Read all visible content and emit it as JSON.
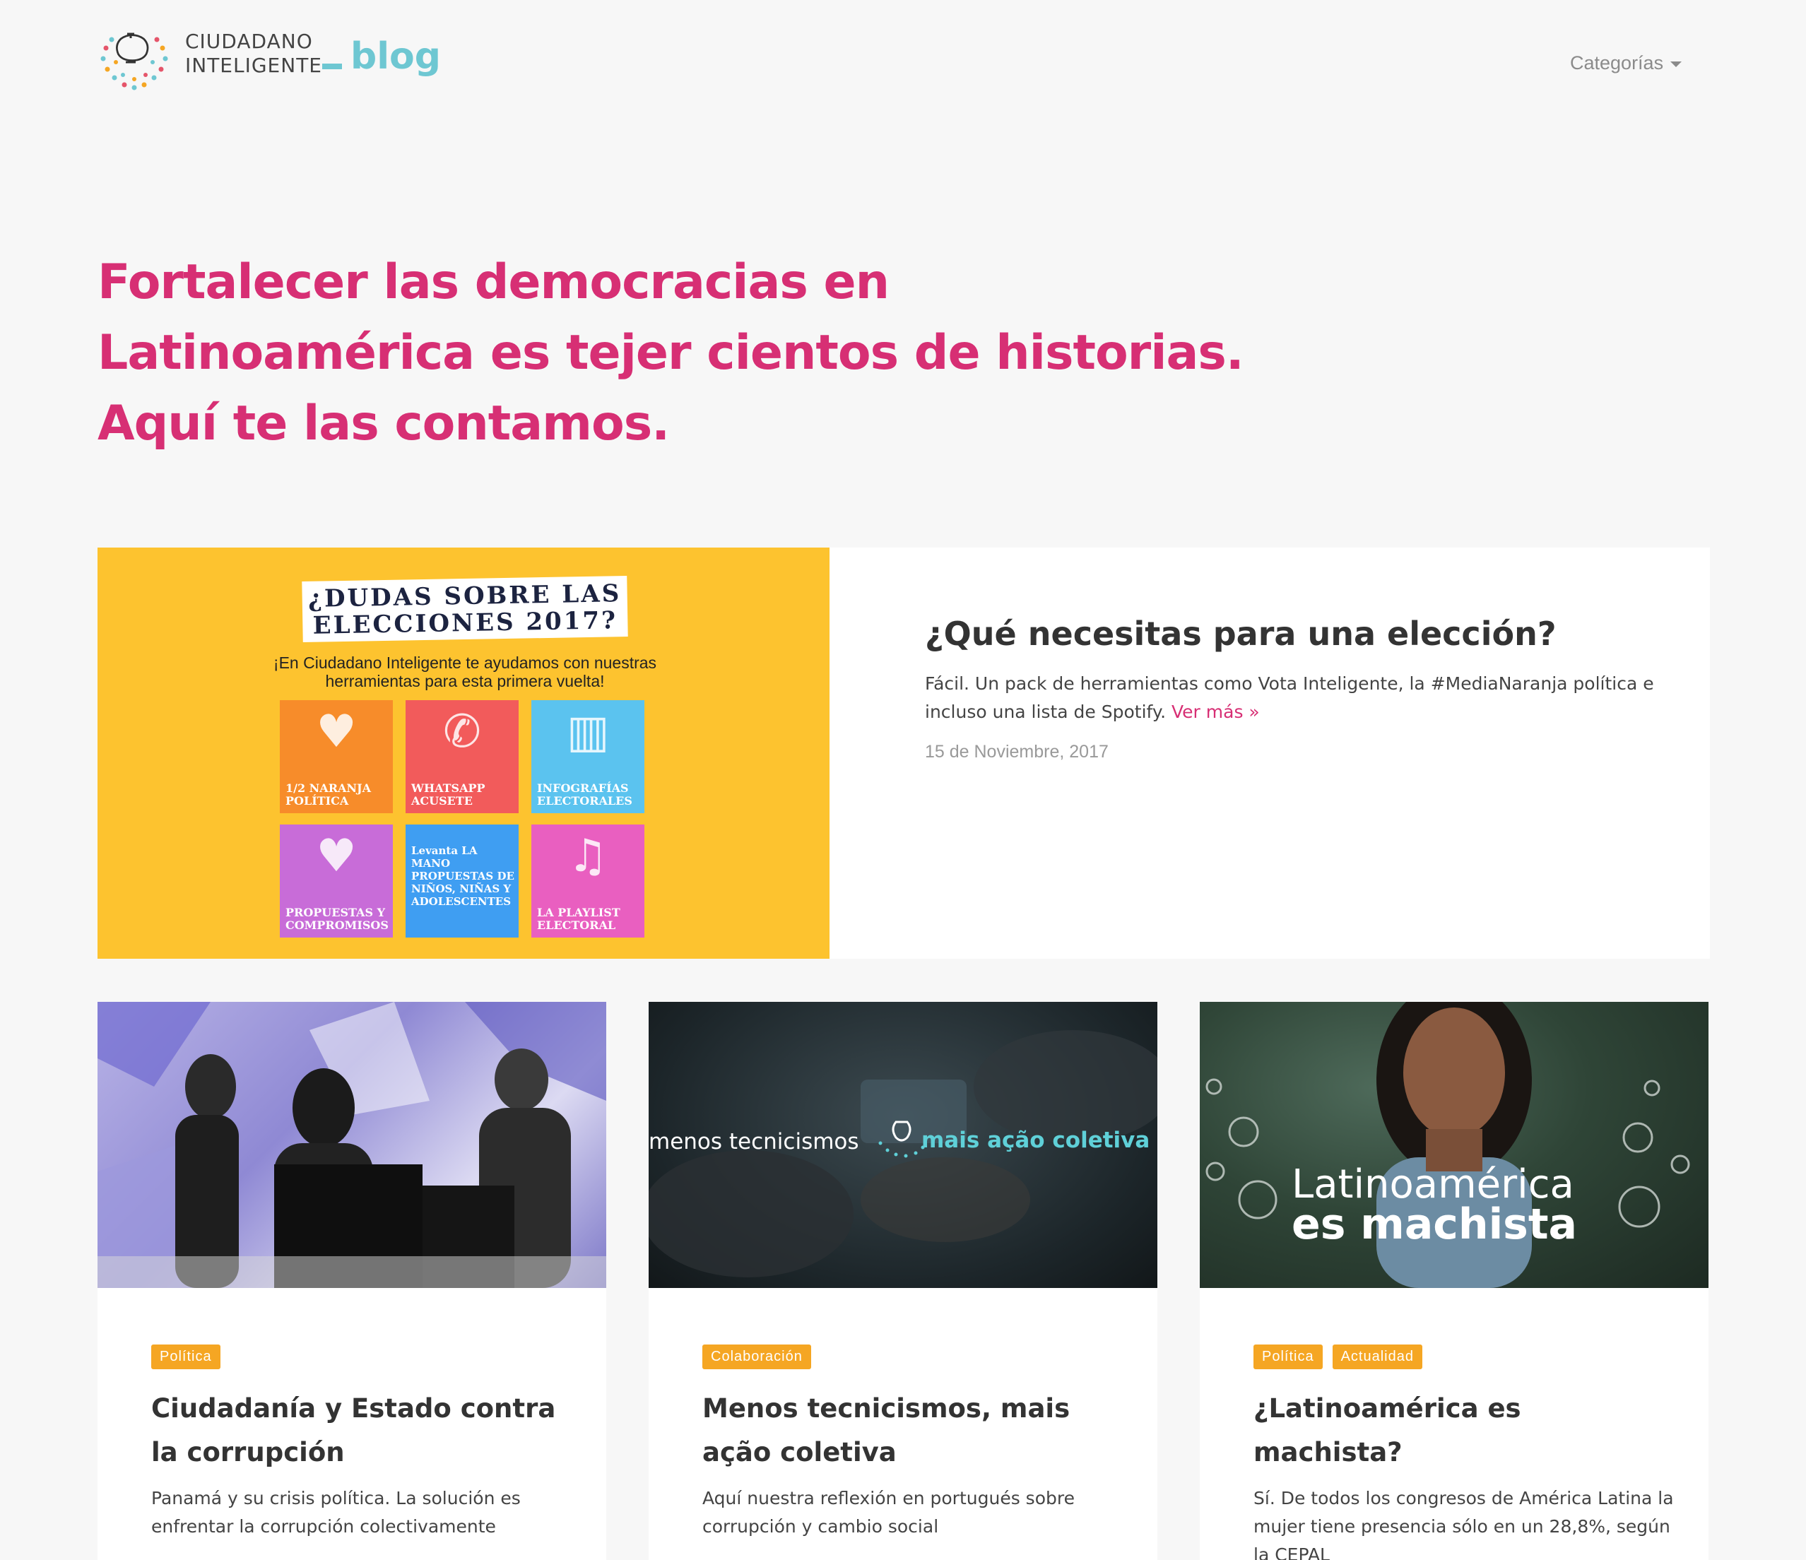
{
  "brand": {
    "line1": "CIUDADANO",
    "line2": "INTELIGENTE",
    "blog": "blog"
  },
  "nav": {
    "categories_label": "Categorías"
  },
  "hero": {
    "lines": [
      "Fortalecer las democracias en",
      "Latinoamérica es tejer cientos de historias.",
      "Aquí te las contamos."
    ],
    "color": "#d72f74"
  },
  "featured": {
    "image": {
      "title_line1": "¿DUDAS SOBRE LAS",
      "title_line2": "ELECCIONES 2017?",
      "subtitle": "¡En Ciudadano Inteligente te ayudamos con nuestras herramientas para esta primera vuelta!",
      "tiles": [
        {
          "label": "1/2 NARANJA POLÍTICA",
          "color": "#f78c2a",
          "icon": "heart-orange-icon"
        },
        {
          "label": "WHATSAPP ACUSETE",
          "color": "#f25b5b",
          "icon": "whatsapp-icon"
        },
        {
          "label": "INFOGRAFÍAS ELECTORALES",
          "color": "#5bc3ef",
          "icon": "chart-icon"
        },
        {
          "label": "PROPUESTAS Y COMPROMISOS",
          "color": "#c86cd8",
          "icon": "heart-hands-icon"
        },
        {
          "label": "Levanta LA MANO PROPUESTAS DE NIÑOS, NIÑAS Y ADOLESCENTES",
          "color": "#3f9ef2",
          "icon": "hand-icon"
        },
        {
          "label": "LA PLAYLIST ELECTORAL",
          "color": "#e95fc0",
          "icon": "music-icon"
        }
      ]
    },
    "title": "¿Qué necesitas para una elección?",
    "description": "Fácil. Un pack de herramientas como Vota Inteligente, la #MediaNaranja política e incluso una lista de Spotify.",
    "more": "Ver más »",
    "date": "15 de Noviembre, 2017"
  },
  "cards": [
    {
      "tags": [
        "Política"
      ],
      "title": "Ciudadanía y Estado contra la corrupción",
      "description": "Panamá y su crisis política. La solución es enfrentar la corrupción colectivamente"
    },
    {
      "tags": [
        "Colaboración"
      ],
      "title": "Menos tecnicismos, mais ação coletiva",
      "description": "Aquí nuestra reflexión en portugués sobre corrupción y cambio social",
      "image_text_left": "menos tecnicismos",
      "image_text_right": "mais ação coletiva"
    },
    {
      "tags": [
        "Política",
        "Actualidad"
      ],
      "title": "¿Latinoamérica es machista?",
      "description": "Sí. De todos los congresos de América Latina la mujer tiene presencia sólo en un 28,8%, según la CEPAL",
      "image_text_line1": "Latinoamérica",
      "image_text_line2": "es machista"
    }
  ],
  "colors": {
    "accent": "#d72f74",
    "tag": "#f5a623",
    "brand_blue": "#6ec7d2",
    "featured_bg": "#fdc32f"
  }
}
